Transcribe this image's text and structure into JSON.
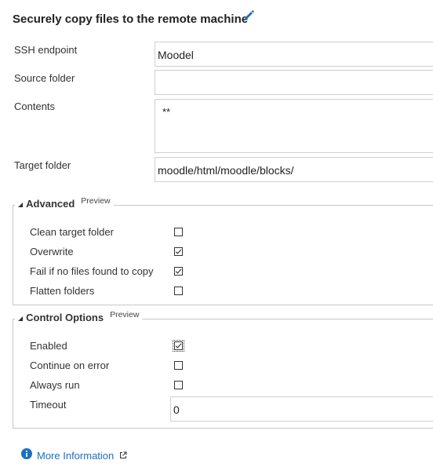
{
  "header": {
    "title": "Securely copy files to the remote machine"
  },
  "fields": {
    "ssh_endpoint": {
      "label": "SSH endpoint",
      "value": "Moodel"
    },
    "source_folder": {
      "label": "Source folder",
      "value": ""
    },
    "contents": {
      "label": "Contents",
      "value": "**"
    },
    "target_folder": {
      "label": "Target folder",
      "value": "moodle/html/moodle/blocks/"
    }
  },
  "advanced": {
    "title": "Advanced",
    "badge": "Preview",
    "options": [
      {
        "label": "Clean target folder",
        "checked": false
      },
      {
        "label": "Overwrite",
        "checked": true
      },
      {
        "label": "Fail if no files found to copy",
        "checked": true
      },
      {
        "label": "Flatten folders",
        "checked": false
      }
    ]
  },
  "control_options": {
    "title": "Control Options",
    "badge": "Preview",
    "options": [
      {
        "label": "Enabled",
        "checked": true
      },
      {
        "label": "Continue on error",
        "checked": false
      },
      {
        "label": "Always run",
        "checked": false
      }
    ],
    "timeout": {
      "label": "Timeout",
      "value": "0"
    }
  },
  "footer": {
    "more_info": "More Information"
  },
  "colors": {
    "accent": "#1b6fc2",
    "pencil": "#1e6fbf"
  }
}
